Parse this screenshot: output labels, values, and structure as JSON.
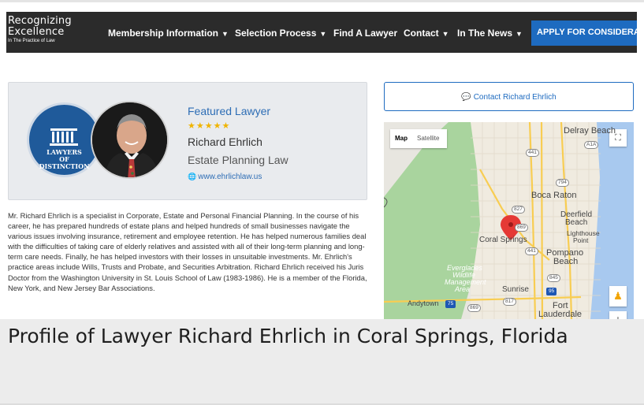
{
  "logo": {
    "line1": "Recognizing",
    "line2": "Excellence",
    "line3": "In The Practice of Law"
  },
  "nav": {
    "items": [
      {
        "label": "Membership Information",
        "dropdown": true
      },
      {
        "label": "Selection Process",
        "dropdown": true
      },
      {
        "label": "Find A Lawyer",
        "dropdown": false
      },
      {
        "label": "Contact",
        "dropdown": true
      },
      {
        "label": "In The News",
        "dropdown": true
      }
    ],
    "apply_label": "APPLY FOR CONSIDERATION"
  },
  "badge": {
    "line1": "LAWYERS",
    "line2": "OF",
    "line3": "DISTINCTION"
  },
  "profile": {
    "featured_label": "Featured Lawyer",
    "stars": "★★★★★",
    "rating": 5,
    "name": "Richard Ehrlich",
    "practice_area": "Estate Planning Law",
    "website": "www.ehrlichlaw.us"
  },
  "bio": "Mr. Richard Ehrlich is a specialist in Corporate, Estate and Personal Financial Planning. In the course of his career, he has prepared hundreds of estate plans and helped hundreds of small businesses navigate the various issues involving insurance, retirement and employee retention. He has helped numerous families deal with the difficulties of taking care of elderly relatives and assisted with all of their long-term planning and long-term care needs. Finally, he has helped investors with their losses in unsuitable investments. Mr. Ehrlich's practice areas include Wills, Trusts and Probate, and Securities Arbitration. Richard Ehrlich received his Juris Doctor from the Washington University in St. Louis School of Law (1983-1986). He is a member of the Florida, New York, and New Jersey Bar Associations.",
  "contact_button": "Contact Richard Ehrlich",
  "map": {
    "type_map": "Map",
    "type_satellite": "Satellite",
    "labels": {
      "delray": "Delray Beach",
      "boca": "Boca Raton",
      "deerfield1": "Deerfield",
      "deerfield2": "Beach",
      "lighthouse1": "Lighthouse",
      "lighthouse2": "Point",
      "coral": "Coral Springs",
      "pompano1": "Pompano",
      "pompano2": "Beach",
      "everglades1": "Everglades",
      "everglades2": "Wildlife",
      "everglades3": "Management",
      "everglades4": "Area",
      "sunrise": "Sunrise",
      "andytown": "Andytown",
      "fort1": "Fort",
      "fort2": "Lauderdale"
    },
    "shields": [
      "441",
      "A1A",
      "794",
      "827",
      "869",
      "441",
      "845",
      "95",
      "817",
      "869",
      "75"
    ],
    "colors": {
      "land": "#e8e6e0",
      "park": "#a9d49e",
      "water": "#a8c9ef",
      "urban": "#f0ebe0",
      "road": "#f8cd52",
      "marker": "#e53935"
    }
  },
  "caption": "Profile of Lawyer Richard Ehrlich in Coral Springs, Florida"
}
